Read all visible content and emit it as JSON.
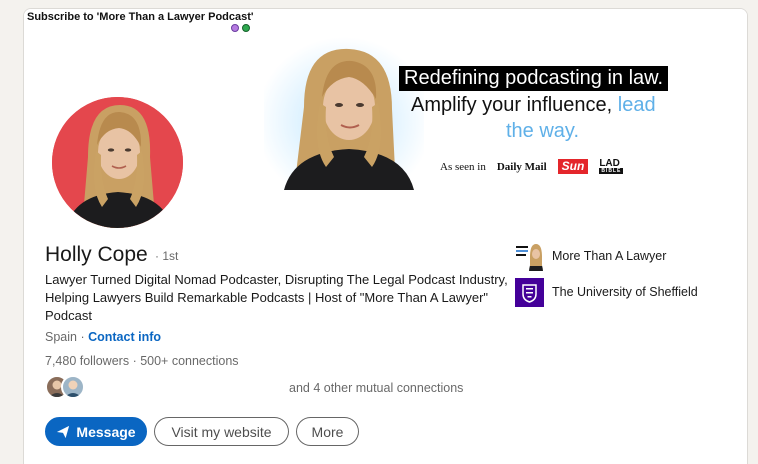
{
  "banner": {
    "subscribe_text": "Subscribe to 'More Than a Lawyer Podcast'",
    "tagline_1": "Redefining podcasting in law.",
    "tagline_2_main": "Amplify your influence,",
    "tagline_2_highlight": "lead",
    "tagline_3": "the way.",
    "as_seen_in": "As seen in",
    "logo_daily_mail": "Daily Mail",
    "logo_sun": "Sun",
    "logo_lad": "LAD",
    "logo_lad_sub": "BIBLE",
    "highlight_color": "#5fb0e8"
  },
  "profile": {
    "name": "Holly Cope",
    "degree": "· 1st",
    "headline": "Lawyer Turned Digital Nomad Podcaster, Disrupting The Legal Podcast Industry, Helping Lawyers Build Remarkable Podcasts | Host of \"More Than A Lawyer\" Podcast",
    "location": "Spain",
    "location_separator": " · ",
    "contact_info": "Contact info",
    "followers": "7,480 followers",
    "connections": "· 500+ connections",
    "mutual_connections": "and 4 other mutual connections"
  },
  "actions": {
    "message": "Message",
    "website": "Visit my website",
    "more": "More"
  },
  "orgs": [
    {
      "name": "More Than A Lawyer",
      "icon": "podcast-logo"
    },
    {
      "name": "The University of Sheffield",
      "icon": "university-crest"
    }
  ],
  "colors": {
    "accent": "#0a66c2",
    "avatar_bg": "#e4474d",
    "sheffield_purple": "#440099",
    "sun_red": "#e4262b"
  }
}
